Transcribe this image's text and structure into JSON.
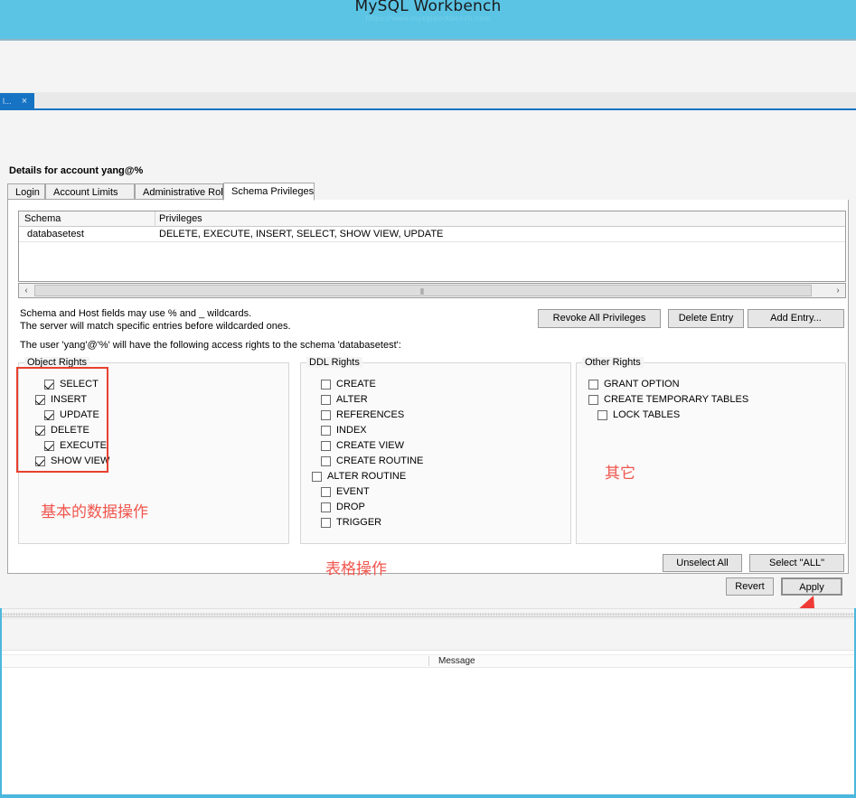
{
  "banner": {
    "title": "MySQL Workbench",
    "subtitle": "https://www.mysqlworkbench.com"
  },
  "editor_tab": {
    "label": "l...",
    "close_icon": "×"
  },
  "details": {
    "header": "Details for account yang@%",
    "tabs": [
      {
        "label": "Login",
        "active": false
      },
      {
        "label": "Account Limits",
        "active": false
      },
      {
        "label": "Administrative Roles",
        "active": false
      },
      {
        "label": "Schema Privileges",
        "active": true
      }
    ]
  },
  "grid": {
    "columns": [
      "Schema",
      "Privileges"
    ],
    "rows": [
      {
        "schema": "databasetest",
        "privileges": "DELETE, EXECUTE, INSERT, SELECT, SHOW VIEW, UPDATE"
      }
    ]
  },
  "scrollbar": {
    "left_arrow": "‹",
    "right_arrow": "›",
    "grip": "⦀"
  },
  "notes": {
    "line1": "Schema and Host fields may use % and _ wildcards.",
    "line2": "The server will match specific entries before wildcarded ones.",
    "line3": "The user 'yang'@'%' will have the following access rights to the schema 'databasetest':"
  },
  "buttons": {
    "revoke_all": "Revoke All Privileges",
    "delete_entry": "Delete Entry",
    "add_entry": "Add Entry...",
    "unselect_all": "Unselect All",
    "select_all": "Select \"ALL\"",
    "revert": "Revert",
    "apply": "Apply"
  },
  "groups": {
    "object_rights": {
      "title": "Object Rights",
      "items": [
        {
          "label": "SELECT",
          "checked": true,
          "indent": 28
        },
        {
          "label": "INSERT",
          "checked": true,
          "indent": 18
        },
        {
          "label": "UPDATE",
          "checked": true,
          "indent": 28
        },
        {
          "label": "DELETE",
          "checked": true,
          "indent": 18
        },
        {
          "label": "EXECUTE",
          "checked": true,
          "indent": 28
        },
        {
          "label": "SHOW VIEW",
          "checked": true,
          "indent": 18
        }
      ]
    },
    "ddl_rights": {
      "title": "DDL Rights",
      "items": [
        {
          "label": "CREATE",
          "checked": false,
          "indent": 22
        },
        {
          "label": "ALTER",
          "checked": false,
          "indent": 22
        },
        {
          "label": "REFERENCES",
          "checked": false,
          "indent": 22
        },
        {
          "label": "INDEX",
          "checked": false,
          "indent": 22
        },
        {
          "label": "CREATE VIEW",
          "checked": false,
          "indent": 22
        },
        {
          "label": "CREATE ROUTINE",
          "checked": false,
          "indent": 22
        },
        {
          "label": "ALTER ROUTINE",
          "checked": false,
          "indent": 12
        },
        {
          "label": "EVENT",
          "checked": false,
          "indent": 22
        },
        {
          "label": "DROP",
          "checked": false,
          "indent": 22
        },
        {
          "label": "TRIGGER",
          "checked": false,
          "indent": 22
        }
      ]
    },
    "other_rights": {
      "title": "Other Rights",
      "items": [
        {
          "label": "GRANT OPTION",
          "checked": false,
          "indent": 13
        },
        {
          "label": "CREATE TEMPORARY TABLES",
          "checked": false,
          "indent": 13
        },
        {
          "label": "LOCK TABLES",
          "checked": false,
          "indent": 23
        }
      ]
    }
  },
  "annotations": {
    "basic": "基本的数据操作",
    "table": "表格操作",
    "other": "其它",
    "highlight_color": "#e8402f",
    "text_color": "#f0564e"
  },
  "output": {
    "message_column": "Message"
  }
}
